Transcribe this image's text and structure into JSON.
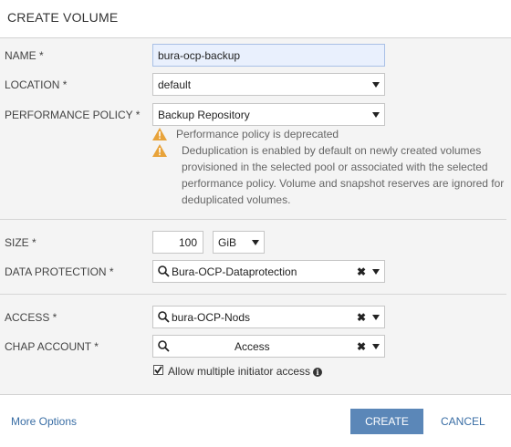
{
  "dialog": {
    "title": "CREATE VOLUME"
  },
  "fields": {
    "name": {
      "label": "NAME *",
      "value": "bura-ocp-backup"
    },
    "location": {
      "label": "LOCATION *",
      "value": "default"
    },
    "performance_policy": {
      "label": "PERFORMANCE POLICY *",
      "value": "Backup Repository"
    },
    "warnings": [
      {
        "icon": "warning-icon",
        "text": "Performance policy is deprecated"
      },
      {
        "icon": "warning-icon",
        "lines": [
          "Deduplication is enabled by default on newly created volumes",
          "provisioned in the selected pool or associated with the selected",
          "performance policy. Volume and snapshot reserves are ignored for",
          "deduplicated volumes."
        ]
      }
    ],
    "size": {
      "label": "SIZE *",
      "value": "100",
      "unit": "GiB"
    },
    "data_protection": {
      "label": "DATA PROTECTION *",
      "value": "Bura-OCP-Dataprotection"
    },
    "access": {
      "label": "ACCESS *",
      "value": "bura-OCP-Nods"
    },
    "chap_account": {
      "label": "CHAP ACCOUNT *",
      "value": "Access"
    },
    "allow_multiple": {
      "label": "Allow multiple initiator access",
      "checked": true
    }
  },
  "footer": {
    "more_options": "More Options",
    "create": "CREATE",
    "cancel": "CANCEL"
  },
  "colors": {
    "accent": "#5b87b8",
    "link": "#3a6ea5",
    "warning": "#e8a33a",
    "section_bg": "#f4f4f4"
  }
}
